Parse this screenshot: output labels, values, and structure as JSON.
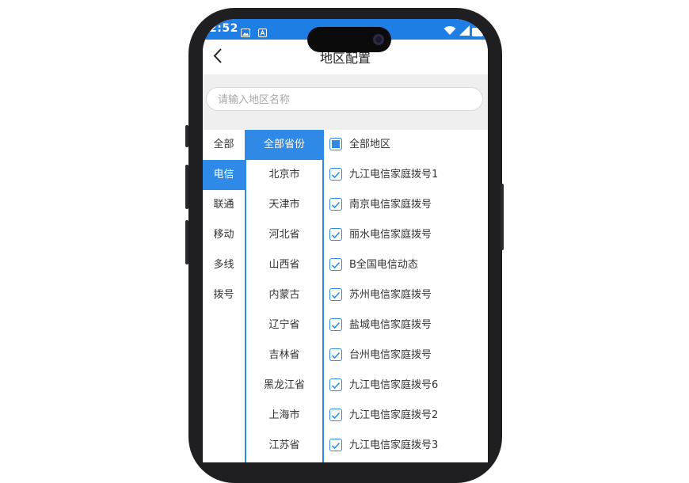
{
  "status_bar": {
    "time": "2:52"
  },
  "navbar": {
    "title": "地区配置"
  },
  "search": {
    "placeholder": "请输入地区名称"
  },
  "operators": [
    {
      "label": "全部",
      "active": false
    },
    {
      "label": "电信",
      "active": true
    },
    {
      "label": "联通",
      "active": false
    },
    {
      "label": "移动",
      "active": false
    },
    {
      "label": "多线",
      "active": false
    },
    {
      "label": "拨号",
      "active": false
    }
  ],
  "provinces": [
    {
      "label": "全部省份",
      "active": true
    },
    {
      "label": "北京市",
      "active": false
    },
    {
      "label": "天津市",
      "active": false
    },
    {
      "label": "河北省",
      "active": false
    },
    {
      "label": "山西省",
      "active": false
    },
    {
      "label": "内蒙古",
      "active": false
    },
    {
      "label": "辽宁省",
      "active": false
    },
    {
      "label": "吉林省",
      "active": false
    },
    {
      "label": "黑龙江省",
      "active": false
    },
    {
      "label": "上海市",
      "active": false
    },
    {
      "label": "江苏省",
      "active": false
    }
  ],
  "regions": [
    {
      "label": "全部地区",
      "state": "partial"
    },
    {
      "label": "九江电信家庭拨号1",
      "state": "checked"
    },
    {
      "label": "南京电信家庭拨号",
      "state": "checked"
    },
    {
      "label": "丽水电信家庭拨号",
      "state": "checked"
    },
    {
      "label": "B全国电信动态",
      "state": "checked"
    },
    {
      "label": "苏州电信家庭拨号",
      "state": "checked"
    },
    {
      "label": "盐城电信家庭拨号",
      "state": "checked"
    },
    {
      "label": "台州电信家庭拨号",
      "state": "checked"
    },
    {
      "label": "九江电信家庭拨号6",
      "state": "checked"
    },
    {
      "label": "九江电信家庭拨号2",
      "state": "checked"
    },
    {
      "label": "九江电信家庭拨号3",
      "state": "checked"
    }
  ],
  "colors": {
    "accent": "#2e8ae6",
    "status_bar": "#1e7ee6"
  }
}
